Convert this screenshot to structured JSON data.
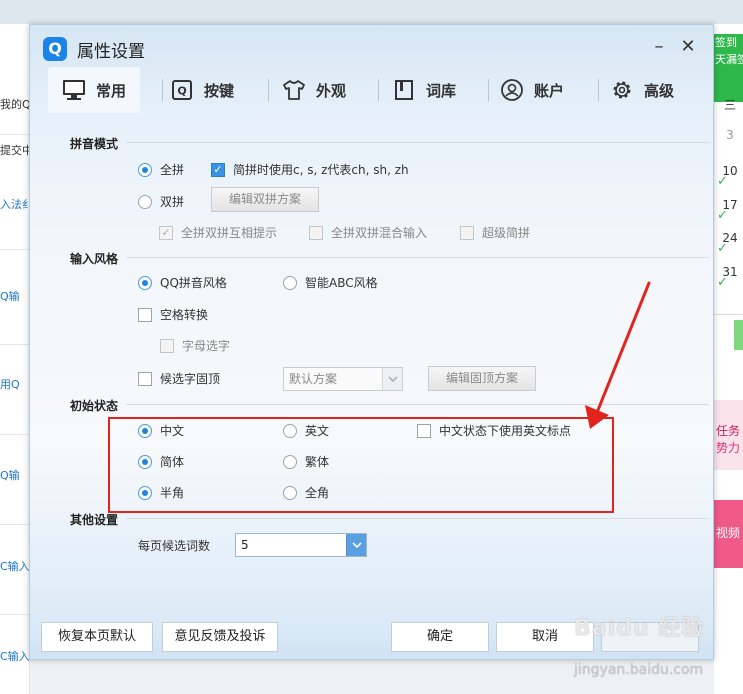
{
  "dialog": {
    "title": "属性设置",
    "logo_letter": "Q",
    "minimize_label": "–",
    "close_label": "✕"
  },
  "tabs": [
    {
      "label": "常用",
      "icon": "monitor-icon",
      "active": true
    },
    {
      "label": "按键",
      "icon": "key-icon",
      "active": false
    },
    {
      "label": "外观",
      "icon": "tshirt-icon",
      "active": false
    },
    {
      "label": "词库",
      "icon": "book-icon",
      "active": false
    },
    {
      "label": "账户",
      "icon": "user-icon",
      "active": false
    },
    {
      "label": "高级",
      "icon": "gear-icon",
      "active": false
    }
  ],
  "pinyin_mode": {
    "title": "拼音模式",
    "full_pinyin": "全拼",
    "abbr_option": "简拼时使用c, s, z代表ch, sh, zh",
    "double_pinyin": "双拼",
    "edit_double_button": "编辑双拼方案",
    "sub_options": [
      "全拼双拼互相提示",
      "全拼双拼混合输入",
      "超级简拼"
    ]
  },
  "input_style": {
    "title": "输入风格",
    "qq_style": "QQ拼音风格",
    "abc_style": "智能ABC风格",
    "space_convert": "空格转换",
    "letter_select": "字母选字",
    "candidate_fix": "候选字固顶",
    "scheme_dropdown": "默认方案",
    "edit_fix_button": "编辑固顶方案"
  },
  "initial_state": {
    "title": "初始状态",
    "chinese": "中文",
    "english": "英文",
    "english_punct": "中文状态下使用英文标点",
    "simplified": "简体",
    "traditional": "繁体",
    "half_width": "半角",
    "full_width": "全角"
  },
  "other_settings": {
    "title": "其他设置",
    "candidates_label": "每页候选词数",
    "candidates_value": "5"
  },
  "footer": {
    "restore_button": "恢复本页默认",
    "feedback_button": "意见反馈及投诉",
    "ok_button": "确定",
    "cancel_button": "取消"
  },
  "background": {
    "left_fragments": [
      "我的Q",
      "提交中",
      "入法纟",
      "Q输",
      "用Q",
      "Q输",
      "C输入",
      "C输入"
    ],
    "right_banner": [
      "签到",
      "天漏签"
    ],
    "right_calendar": [
      "三",
      "3",
      "10",
      "17",
      "24",
      "31"
    ],
    "right_pink": [
      "任务",
      "势力",
      "视频"
    ]
  },
  "watermark": {
    "line1": "Baidu 经验",
    "line2": "jingyan.baidu.com"
  },
  "colors": {
    "accent": "#1e86e0",
    "highlight_box": "#e3231e",
    "arrow": "#e3231e"
  }
}
